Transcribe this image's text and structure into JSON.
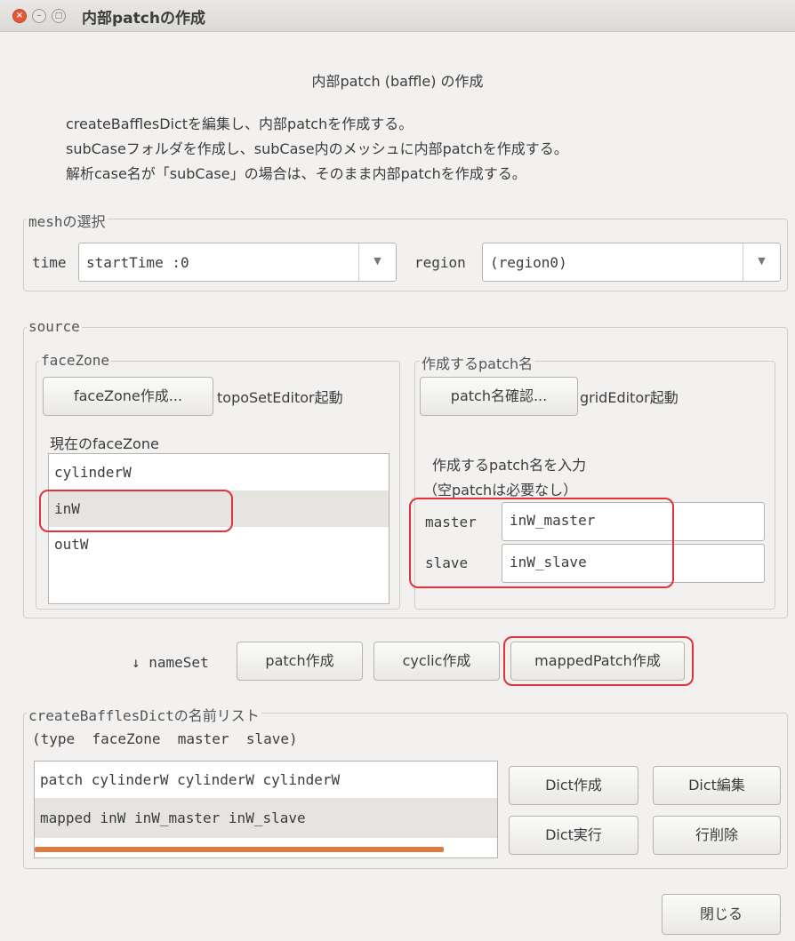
{
  "window": {
    "title": "内部patchの作成",
    "close_glyph": "×",
    "min_glyph": "–",
    "max_glyph": "□"
  },
  "header": {
    "heading": "内部patch (baffle) の作成",
    "desc": [
      "createBafflesDictを編集し、内部patchを作成する。",
      "subCaseフォルダを作成し、subCase内のメッシュに内部patchを作成する。",
      "解析case名が「subCase」の場合は、そのまま内部patchを作成する。"
    ]
  },
  "mesh": {
    "group_label": "meshの選択",
    "time_label": "time",
    "time_value": "startTime :0",
    "region_label": "region",
    "region_value": "(region0)"
  },
  "source": {
    "group_label": "source",
    "facezone": {
      "group_label": "faceZone",
      "create_button": "faceZone作成...",
      "editor_label": "topoSetEditor起動",
      "current_label": "現在のfaceZone",
      "items": [
        "cylinderW",
        "inW",
        "outW"
      ]
    },
    "patchname": {
      "group_label": "作成するpatch名",
      "check_button": "patch名確認...",
      "editor_label": "gridEditor起動",
      "hint1": "作成するpatch名を入力",
      "hint2": "（空patchは必要なし）",
      "master_label": "master",
      "master_value": "inW_master",
      "slave_label": "slave",
      "slave_value": "inW_slave"
    }
  },
  "nameset": {
    "label": "↓ nameSet",
    "patch_button": "patch作成",
    "cyclic_button": "cyclic作成",
    "mapped_button": "mappedPatch作成"
  },
  "dictlist": {
    "group_label": "createBafflesDictの名前リスト",
    "columns_label": "(type  faceZone  master  slave)",
    "rows": [
      "patch cylinderW cylinderW cylinderW",
      "mapped inW inW_master inW_slave"
    ],
    "create_button": "Dict作成",
    "edit_button": "Dict編集",
    "run_button": "Dict実行",
    "delete_button": "行削除"
  },
  "footer": {
    "close_button": "閉じる"
  },
  "colors": {
    "highlight": "#e2323c",
    "scrollbar": "#e07a3f"
  }
}
